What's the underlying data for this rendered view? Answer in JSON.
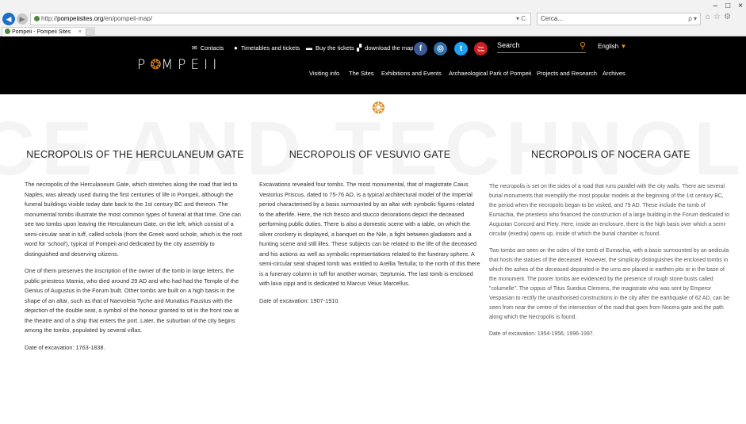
{
  "browser": {
    "url_prefix": "http://",
    "url_host": "pompeiisites.org",
    "url_path": "/en/pompeii-map/",
    "address_controls": "▾ C",
    "search_placeholder": "Cerca...",
    "search_controls": "ρ ▾",
    "tab_title": "Pompeii - Pompeii Sites",
    "tab_close": "×",
    "window_controls": [
      "–",
      "□",
      "×"
    ]
  },
  "header": {
    "toplinks": {
      "contacts": "Contacts",
      "timetables": "Timetables and tickets",
      "buy_tickets": "Buy the tickets",
      "download_map": "download the map"
    },
    "social": [
      "f",
      "◎",
      "t",
      "You Tube"
    ],
    "search_label": "Search",
    "language": "English",
    "logo_left": "P",
    "logo_right": "MPEII",
    "nav": [
      "Visiting info",
      "The Sites",
      "Exhibitions and Events",
      "Archaeological Park of Pompeii",
      "Projects and Research",
      "Archives"
    ]
  },
  "columns": [
    {
      "title": "NECROPOLIS OF THE HERCULANEUM GATE",
      "paragraphs": [
        "The necropolis of the Herculaneum Gate, which stretches along the road that led to Naples, was already used during the first centuries of life in Pompeii, although the funeral buildings visible today date back to the 1st century BC and thereon. The monumental tombs illustrate the most common types of funeral at that time. One can see two tombs upon leaving the Herculaneum Gate, on the left, which consist of a semi-circular seat in tuff, called schola (from the Greek word schole, which is the root word for 'school'), typical of Pompeii and dedicated by the city assembly to distinguished and deserving citizens.",
        "One of them preserves the inscription of the owner of the tomb in large letters, the public priestess Mamia, who died around 29 AD and who had had the Temple of the Genius of Augustus in the Forum built. Other tombs are built on a high basis in the shape of an altar, such as that of Naevoleia Tyche and Munatius Faustus with the depiction of the double seat, a symbol of the honour granted to sit in the front row at the theatre and of a ship that enters the port. Later, the suburban of the city begins among the tombs, populated by several villas.",
        "Date of excavation: 1763-1838."
      ]
    },
    {
      "title": "NECROPOLIS OF VESUVIO GATE",
      "paragraphs": [
        "Excavations revealed four tombs. The most monumental, that of magistrate Caius Vestorius Priscus, dated to 75-76 AD, is a typical architectural model of the Imperial period characterised by a basis surmounted by an altar with symbolic figures related to the afterlife. Here, the rich fresco and stucco decorations depict the deceased performing public duties. There is also a domestic scene with a table, on which the silver crockery is displayed, a banquet on the Nile, a fight between gladiators and a hunting scene and still lifes. These subjects can be related to the life of the deceased and his actions as well as symbolic representations related to the funerary sphere. A semi-circular seat shaped tomb was entitled to Arellia Tertulla; to the north of this there is a funerary column in tuff for another woman, Septumia. The last tomb is enclosed with lava cippi and is dedicated to Marcus Veius Marcellus.",
        "Date of excavation: 1907-1910."
      ]
    },
    {
      "title": "NECROPOLIS OF NOCERA GATE",
      "paragraphs": [
        "The necropolis is set on the sides of a road that runs parallel with the city walls. There are several burial monuments that exemplify the most popular models at the beginning of the 1st century BC, the period when the necropolis began to be visited, and 79 AD. These include the tomb of Eumachia, the priestess who financed the construction of a large building in the Forum dedicated to Augustan Concord and Piety. Here, inside an enclosure, there is the high basis over which a semi-circular (exedra) opens up, inside of which the burial chamber is found.",
        "Two tombs are seen on the sides of the tomb of Eumachia, with a basis surmounted by an aedicula that hosts the statues of the deceased. However, the simplicity distinguishes the enclosed tombs in which the ashes of the deceased deposited in the urns are placed in earthen pits or in the base of the monument. The poorer tombs are evidenced by the presence of rough stone busts called \"columelle\". The cippus of Titus Suedius Clemens, the magistrate who was sent by Emperor Vespasian to rectify the unauthorised constructions in the city after the earthquake of 62 AD, can be seen from near the centre of the intersection of the road that goes from Nocera gate and the path along which the Necropolis is found.",
        "Date of excavation: 1954-1956; 1996-1997."
      ]
    }
  ],
  "watermark_text": "SCITEPRESS SCIENCE AND TECHNOLOGY PUBLICATIONS",
  "colors": {
    "accent": "#e08a1e",
    "header_bg": "#000000",
    "facebook": "#3b5998",
    "twitter": "#1da1f2",
    "youtube": "#cc1f1f",
    "instagram": "#2e6ea8"
  },
  "icons": [
    "back-arrow-icon",
    "forward-arrow-icon",
    "envelope-icon",
    "clock-icon",
    "card-icon",
    "map-icon",
    "search-icon",
    "sun-logo-icon"
  ]
}
